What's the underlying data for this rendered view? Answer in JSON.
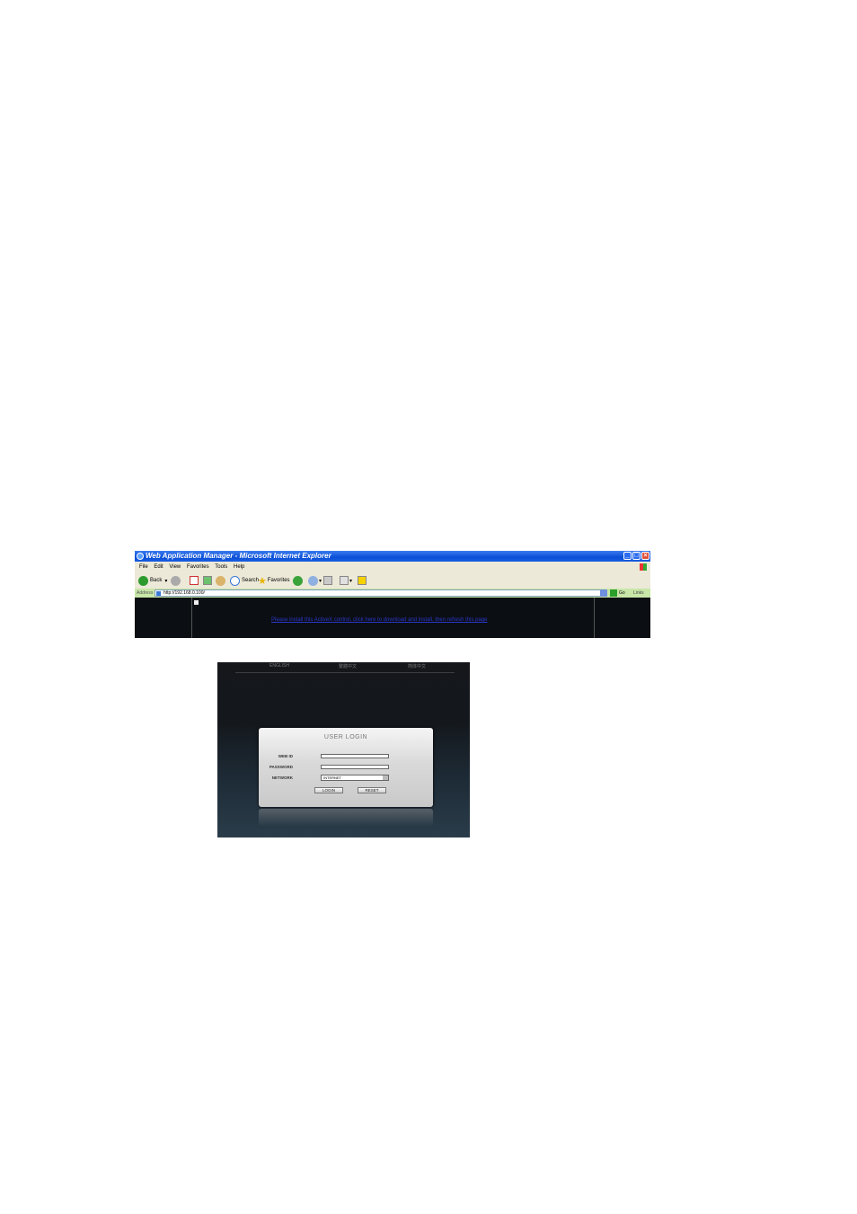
{
  "browser": {
    "title": "Web Application Manager - Microsoft Internet Explorer",
    "menu": [
      "File",
      "Edit",
      "View",
      "Favorites",
      "Tools",
      "Help"
    ],
    "toolbar": {
      "back": "Back",
      "search": "Search",
      "favorites": "Favorites"
    },
    "address": {
      "label": "Address",
      "value": "http://192.168.0.100/",
      "go": "Go",
      "links": "Links"
    },
    "content": {
      "info_link": "Please install this ActiveX control, click here to download and install, then refresh this page"
    }
  },
  "login": {
    "languages": [
      "ENGLISH",
      "繁體中文",
      "简体中文"
    ],
    "title": "USER LOGIN",
    "web_id_label": "WEB ID",
    "password_label": "PASSWORD",
    "network_label": "NETWORK",
    "network_value": "INTERNET",
    "login_button": "LOGIN",
    "reset_button": "RESET"
  }
}
